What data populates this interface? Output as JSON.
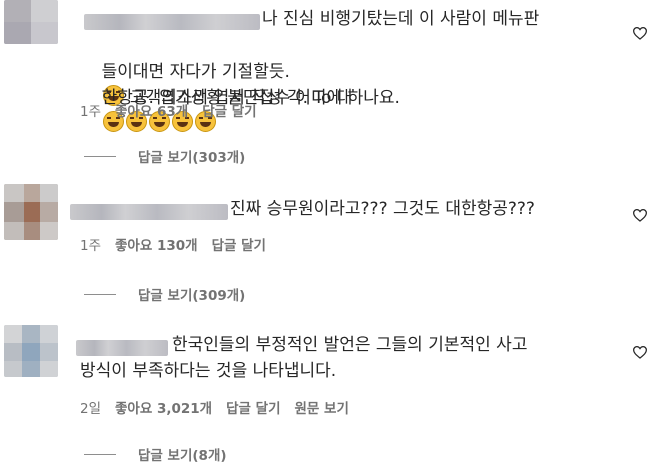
{
  "comments": [
    {
      "lines": [
        "나 진심 비행기탔는데 이 사람이 메뉴판",
        "들이대면 자다가 기절할듯.",
        " 고객의소리 엽서 작성 각. To 대",
        "한항공. 엽기상황 불만접수 어디에 하나요."
      ],
      "time": "1주",
      "likes": "좋아요 63개",
      "reply": "답글 달기",
      "view_replies": "답글 보기(303개)"
    },
    {
      "lines": [
        "진짜 승무원이라고??? 그것도 대한항공???"
      ],
      "time": "1주",
      "likes": "좋아요 130개",
      "reply": "답글 달기",
      "view_replies": "답글 보기(309개)"
    },
    {
      "lines": [
        "한국인들의 부정적인 발언은 그들의 기본적인 사고",
        "방식이 부족하다는 것을 나타냅니다."
      ],
      "time": "2일",
      "likes": "좋아요 3,021개",
      "reply": "답글 달기",
      "translate": "원문 보기",
      "view_replies": "답글 보기(8개)"
    }
  ],
  "icons": {
    "like": "heart-outline-icon",
    "emoji": "laughing-with-tears-emoji"
  }
}
